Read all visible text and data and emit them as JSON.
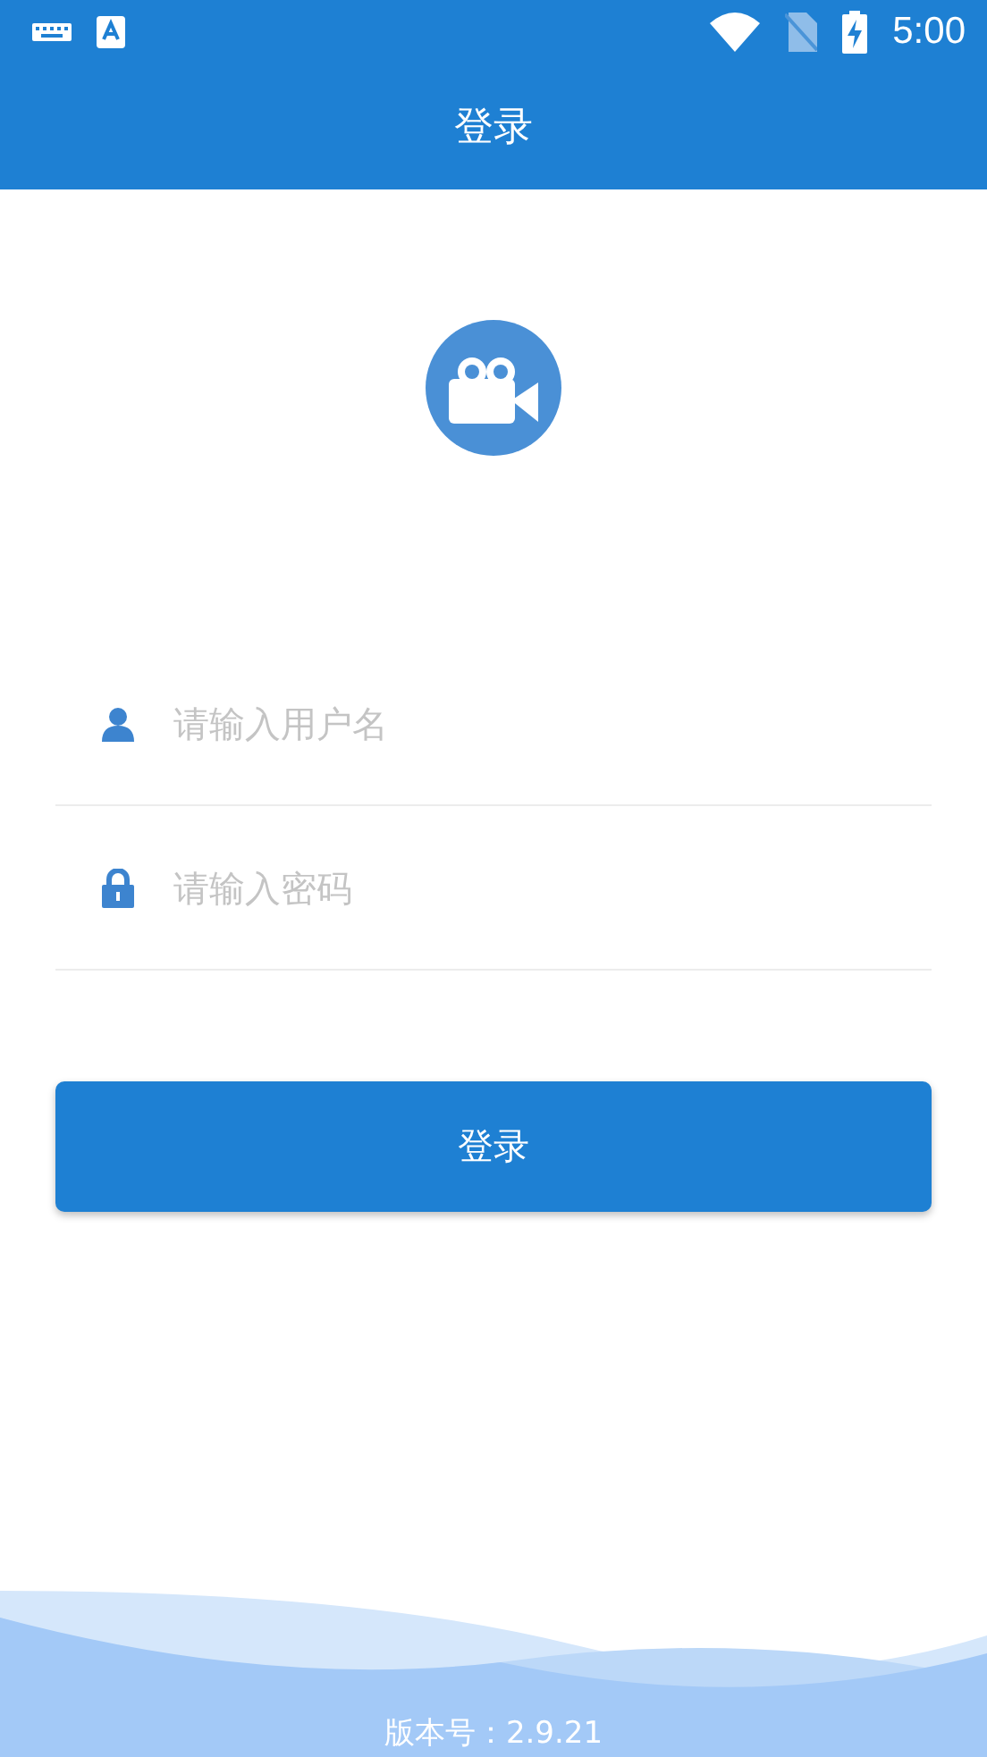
{
  "status_bar": {
    "time": "5:00"
  },
  "header": {
    "title": "登录"
  },
  "form": {
    "fields": [
      {
        "kind": "user",
        "placeholder": "请输入用户名"
      },
      {
        "kind": "lock",
        "placeholder": "请输入密码"
      }
    ],
    "submit": "登录"
  },
  "footer": {
    "version": "版本号：2.9.21"
  }
}
